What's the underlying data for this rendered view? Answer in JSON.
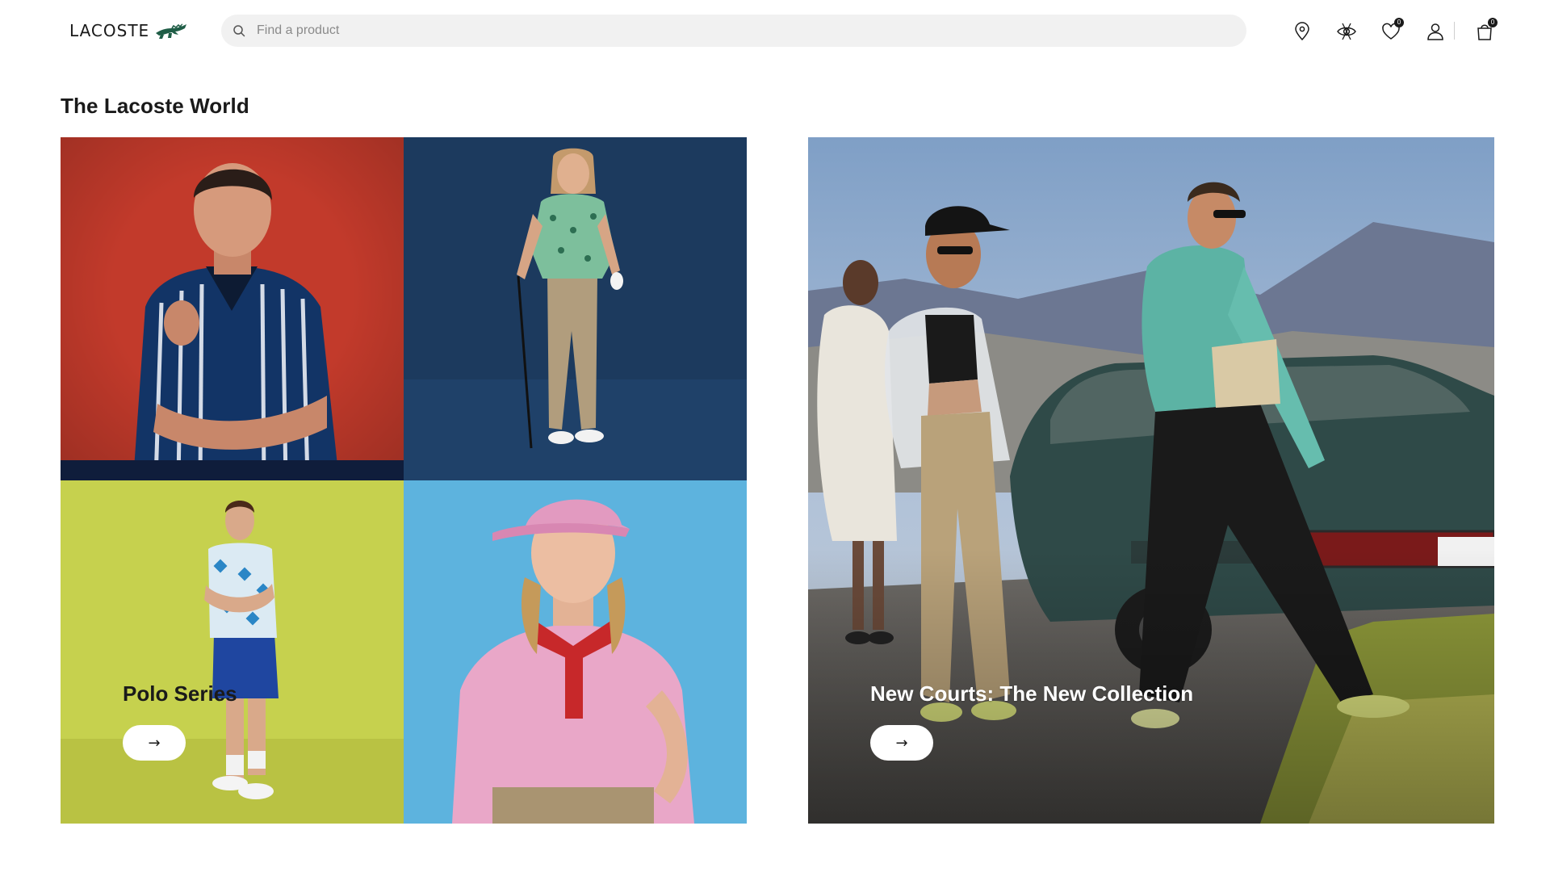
{
  "header": {
    "logo_text": "LACOSTE",
    "logo_icon": "crocodile-logo-icon",
    "search": {
      "placeholder": "Find a product",
      "value": ""
    },
    "icons": [
      {
        "name": "store-locator-icon"
      },
      {
        "name": "vision-eye-icon"
      },
      {
        "name": "wishlist-heart-icon",
        "badge": "0"
      },
      {
        "name": "account-user-icon"
      },
      {
        "name": "shopping-bag-icon",
        "badge": "0"
      }
    ]
  },
  "section": {
    "title": "The Lacoste World",
    "cards": [
      {
        "label": "Polo Series",
        "button_label": "→"
      },
      {
        "label": "New Courts: The New Collection",
        "button_label": "→"
      }
    ]
  },
  "colors": {
    "text": "#1a1a1a",
    "search_bg": "#f1f1f1",
    "tile_red": "#c23a2b",
    "tile_navy": "#1c3a5e",
    "tile_lime": "#c6d14e",
    "tile_sky": "#5db3de",
    "brand_green": "#1f5d46"
  }
}
